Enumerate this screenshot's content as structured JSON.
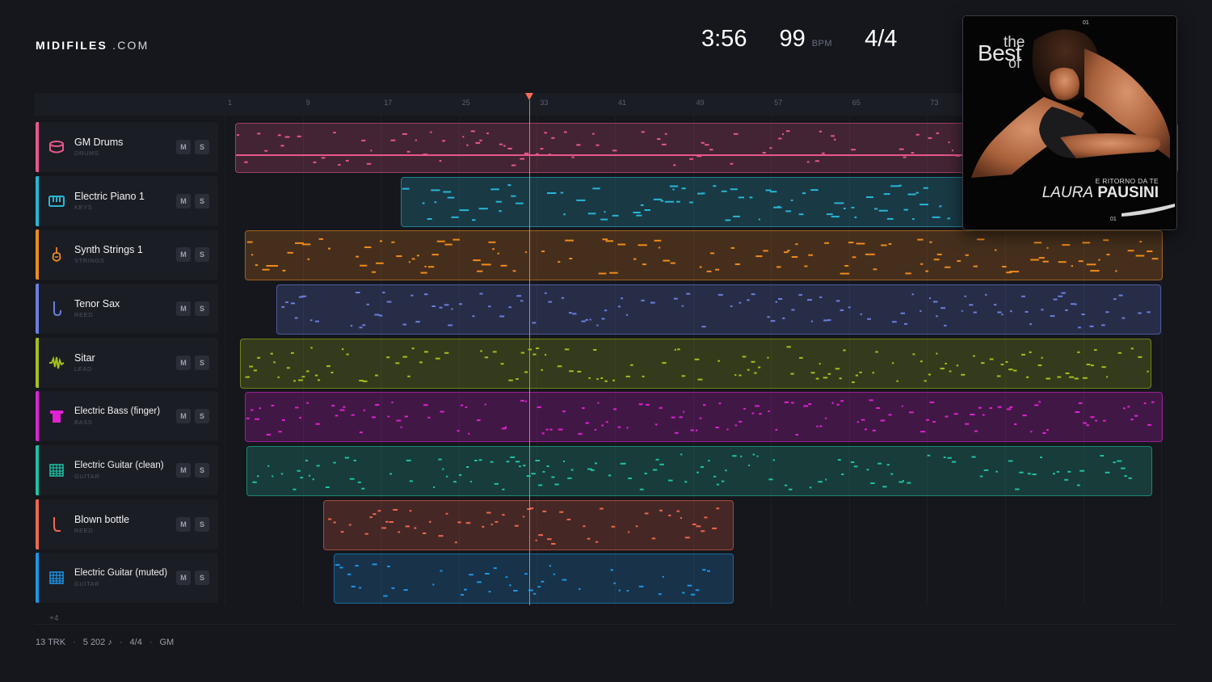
{
  "brand": {
    "name": "MIDIFILES",
    "suffix": ".COM"
  },
  "header": {
    "duration": "3:56",
    "tempo": "99",
    "tempo_unit": "BPM",
    "time_signature": "4/4"
  },
  "ruler": {
    "ticks": [
      "1",
      "9",
      "17",
      "25",
      "33",
      "41",
      "49",
      "57",
      "65",
      "73"
    ]
  },
  "tracks": [
    {
      "name": "GM Drums",
      "category": "DRUMS",
      "color": "#e8578a",
      "icon": "drum-icon",
      "mute": "M",
      "solo": "S"
    },
    {
      "name": "Electric Piano 1",
      "category": "KEYS",
      "color": "#27b6d6",
      "icon": "piano-icon",
      "mute": "M",
      "solo": "S"
    },
    {
      "name": "Synth Strings 1",
      "category": "STRINGS",
      "color": "#f08a1c",
      "icon": "violin-icon",
      "mute": "M",
      "solo": "S"
    },
    {
      "name": "Tenor Sax",
      "category": "REED",
      "color": "#6b7fe0",
      "icon": "saxophone-icon",
      "mute": "M",
      "solo": "S"
    },
    {
      "name": "Sitar",
      "category": "LEAD",
      "color": "#a3c01c",
      "icon": "waveform-icon",
      "mute": "M",
      "solo": "S"
    },
    {
      "name": "Electric Bass (finger)",
      "category": "BASS",
      "color": "#e021d4",
      "icon": "bass-amp-icon",
      "mute": "M",
      "solo": "S"
    },
    {
      "name": "Electric Guitar (clean)",
      "category": "GUITAR",
      "color": "#1fc2a6",
      "icon": "guitar-fretboard-icon",
      "mute": "M",
      "solo": "S"
    },
    {
      "name": "Blown bottle",
      "category": "REED",
      "color": "#f0674a",
      "icon": "bottle-icon",
      "mute": "M",
      "solo": "S"
    },
    {
      "name": "Electric Guitar (muted)",
      "category": "GUITAR",
      "color": "#1e95e8",
      "icon": "guitar-fretboard-icon",
      "mute": "M",
      "solo": "S"
    }
  ],
  "more_tracks": "+4",
  "footer": {
    "tracks": "13 TRK",
    "notes": "5 202 ♪",
    "meter": "4/4",
    "standard": "GM"
  },
  "album": {
    "title_the": "the",
    "title_best": "Best",
    "title_of": "of",
    "subtitle": "E RITORNO DA TE",
    "artist_first": "LAURA",
    "artist_last": "PAUSINI",
    "code_top": "01",
    "code_bottom": "01"
  }
}
